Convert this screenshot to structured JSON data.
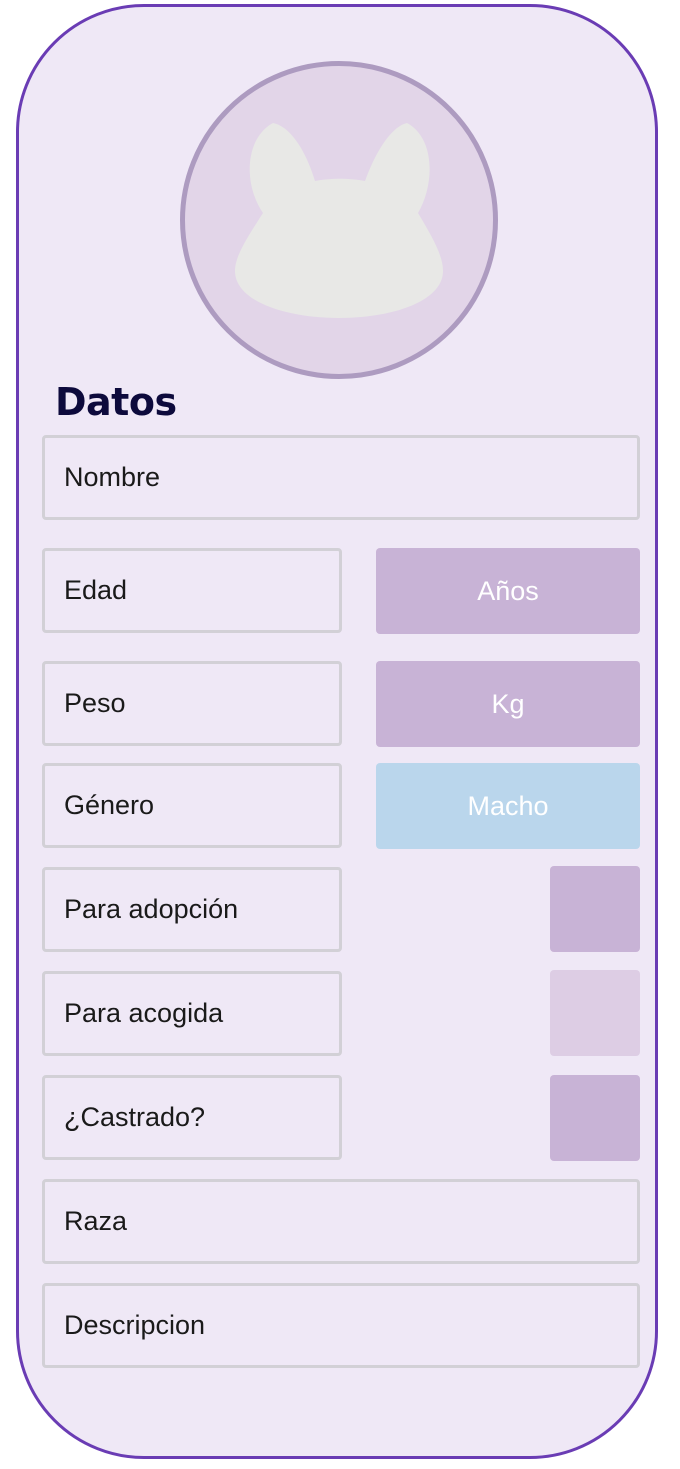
{
  "form": {
    "section_title": "Datos",
    "fields": {
      "nombre": "Nombre",
      "edad": "Edad",
      "peso": "Peso",
      "genero": "Género",
      "para_adopcion": "Para adopción",
      "para_acogida": "Para acogida",
      "castrado": "¿Castrado?",
      "raza": "Raza",
      "descripcion": "Descripcion"
    },
    "units": {
      "edad": "Años",
      "peso": "Kg"
    },
    "genero_value": "Macho",
    "toggles": {
      "para_adopcion": "on",
      "para_acogida": "off",
      "castrado": "on"
    }
  },
  "avatar": {
    "icon": "cat-silhouette-icon"
  },
  "colors": {
    "card_border": "#6a3cb4",
    "card_background": "#efe8f6",
    "title": "#0d0a3c",
    "unit_button": "#c8b3d6",
    "gender_button": "#bad6ec",
    "toggle_on": "#c8b3d6",
    "toggle_off": "#ddcde4"
  }
}
